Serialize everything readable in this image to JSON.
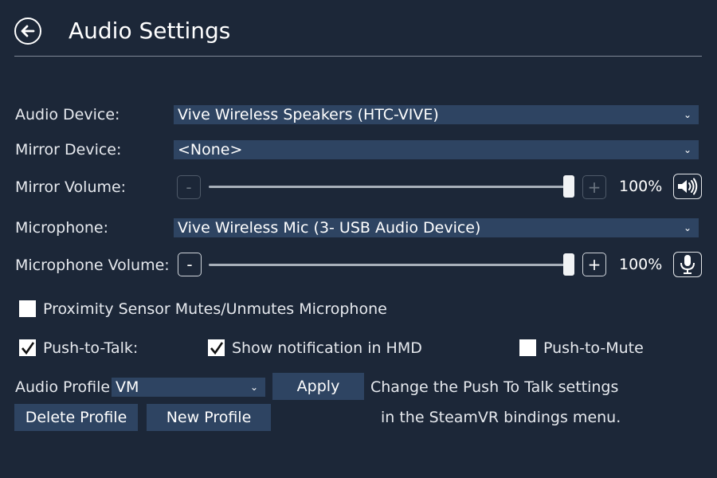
{
  "header": {
    "title": "Audio Settings",
    "back_icon": "back-arrow-circle-icon"
  },
  "rows": {
    "audio_device": {
      "label": "Audio Device:",
      "value": "Vive Wireless Speakers (HTC-VIVE)"
    },
    "mirror_device": {
      "label": "Mirror Device:",
      "value": "<None>"
    },
    "mirror_volume": {
      "label": "Mirror Volume:",
      "minus": "-",
      "plus": "+",
      "percent": "100%",
      "level": 1.0,
      "enabled": false,
      "icon": "speaker-volume-icon"
    },
    "microphone": {
      "label": "Microphone:",
      "value": "Vive Wireless Mic (3- USB Audio Device)"
    },
    "microphone_volume": {
      "label": "Microphone Volume:",
      "minus": "-",
      "plus": "+",
      "percent": "100%",
      "level": 1.0,
      "enabled": true,
      "icon": "microphone-icon"
    }
  },
  "options": {
    "proximity": {
      "label": "Proximity Sensor Mutes/Unmutes Microphone",
      "checked": false
    },
    "push_to_talk": {
      "label": "Push-to-Talk:",
      "checked": true
    },
    "show_notification": {
      "label": "Show notification in HMD",
      "checked": true
    },
    "push_to_mute": {
      "label": "Push-to-Mute",
      "checked": false
    }
  },
  "profile": {
    "label": "Audio Profile:",
    "value": "VM",
    "apply_label": "Apply",
    "delete_label": "Delete Profile",
    "new_label": "New Profile",
    "note_line1": "Change the Push To Talk settings",
    "note_line2": "in the SteamVR bindings menu."
  },
  "colors": {
    "background": "#1c2738",
    "control": "#2e4462",
    "text": "#e6e9ee"
  }
}
